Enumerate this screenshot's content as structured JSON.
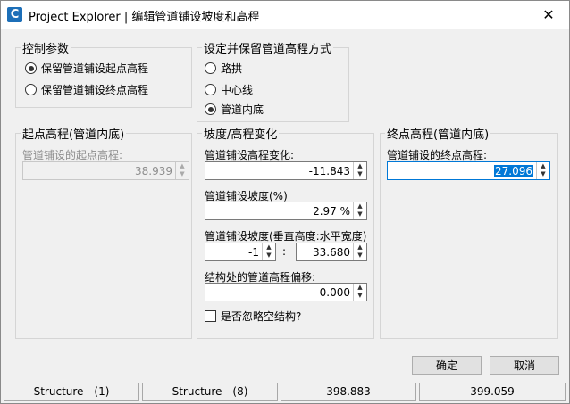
{
  "window": {
    "title": "Project Explorer | 编辑管道铺设坡度和高程",
    "close": "✕"
  },
  "control_params": {
    "label": "控制参数",
    "options": [
      {
        "label": "保留管道铺设起点高程",
        "checked": true
      },
      {
        "label": "保留管道铺设终点高程",
        "checked": false
      }
    ]
  },
  "elevation_method": {
    "label": "设定并保留管道高程方式",
    "options": [
      {
        "label": "路拱",
        "checked": false
      },
      {
        "label": "中心线",
        "checked": false
      },
      {
        "label": "管道内底",
        "checked": true
      }
    ]
  },
  "start_elev": {
    "label": "起点高程(管道内底)",
    "field_label": "管道铺设的起点高程:",
    "value": "38.939"
  },
  "slope": {
    "label": "坡度/高程变化",
    "elev_change_label": "管道铺设高程变化:",
    "elev_change": "-11.843",
    "slope_pct_label": "管道铺设坡度(%)",
    "slope_pct": "2.97 %",
    "ratio_label": "管道铺设坡度(垂直高度:水平宽度)",
    "ratio_v": "-1",
    "ratio_sep": ":",
    "ratio_h": "33.680",
    "offset_label": "结构处的管道高程偏移:",
    "offset": "0.000",
    "ignore_label": "是否忽略空结构?"
  },
  "end_elev": {
    "label": "终点高程(管道内底)",
    "field_label": "管道铺设的终点高程:",
    "value": "27.096"
  },
  "buttons": {
    "ok": "确定",
    "cancel": "取消"
  },
  "status": [
    "Structure - (1)",
    "Structure - (8)",
    "398.883",
    "399.059"
  ],
  "icons": {
    "up": "▲",
    "down": "▼"
  }
}
